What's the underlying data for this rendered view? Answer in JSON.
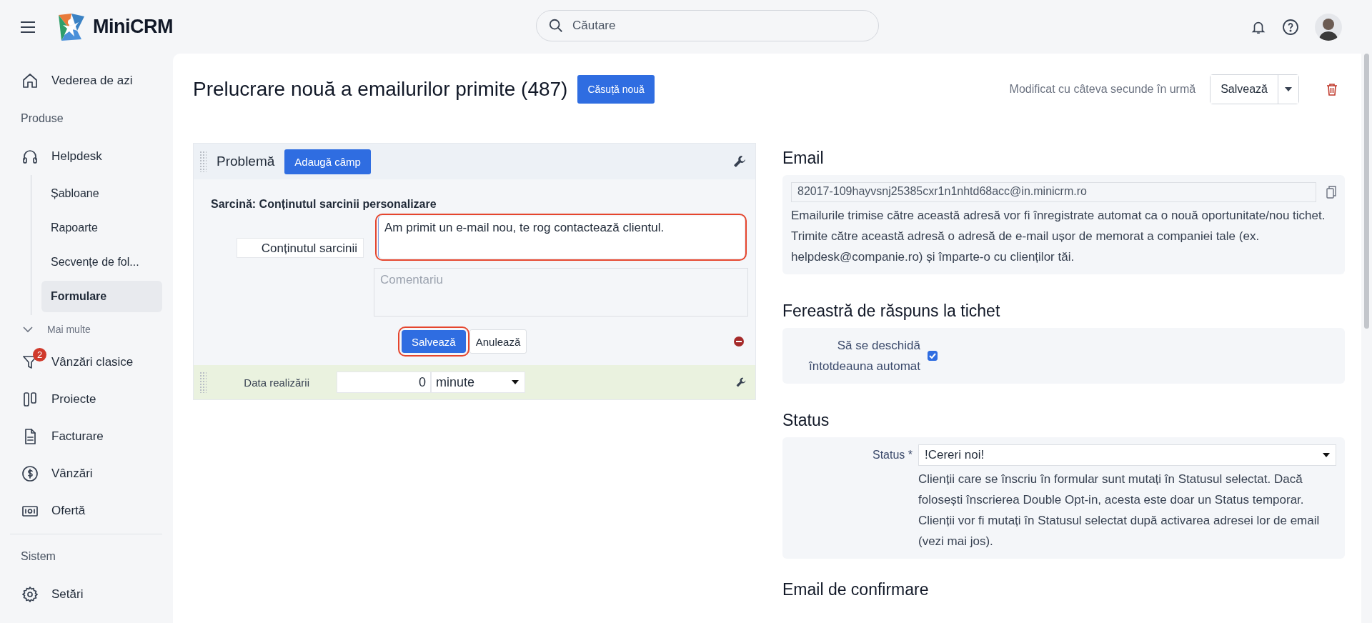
{
  "header": {
    "logo": "MiniCRM",
    "search": {
      "placeholder": "Căutare"
    }
  },
  "sidebar": [
    {
      "kind": "nav",
      "label": "Vederea de azi"
    },
    {
      "kind": "heading",
      "label": "Produse"
    },
    {
      "kind": "nav",
      "label": "Helpdesk",
      "children": [
        {
          "label": "Șabloane",
          "selected": false
        },
        {
          "label": "Rapoarte",
          "selected": false
        },
        {
          "label": "Secvențe de fol...",
          "selected": false
        },
        {
          "label": "Formulare",
          "selected": true
        }
      ]
    },
    {
      "kind": "more",
      "label": "Mai multe"
    },
    {
      "kind": "nav",
      "label": "Vânzări clasice",
      "badge": "2"
    },
    {
      "kind": "nav",
      "label": "Proiecte"
    },
    {
      "kind": "nav",
      "label": "Facturare"
    },
    {
      "kind": "nav",
      "label": "Vânzări"
    },
    {
      "kind": "nav",
      "label": "Ofertă"
    },
    {
      "kind": "divider"
    },
    {
      "kind": "heading",
      "label": "Sistem"
    },
    {
      "kind": "nav",
      "label": "Setări"
    }
  ],
  "page": {
    "title": "Prelucrare nouă a emailurilor primite (487)",
    "new_button": "Căsuță nouă",
    "modified": "Modificat cu câteva secunde în urmă",
    "save": "Salvează"
  },
  "form": {
    "section_title": "Problemă",
    "add_field": "Adaugă câmp",
    "task_heading": "Sarcină: Conținutul sarcinii personalizare",
    "field_label": "Conținutul sarcinii",
    "field_value": "Am primit un e-mail nou, te rog contactează clientul.",
    "field_highlighted": true,
    "comment": {
      "placeholder": "Comentariu"
    },
    "save": {
      "label": "Salvează",
      "highlighted": true
    },
    "cancel": "Anulează",
    "due": {
      "label": "Data realizării",
      "value": "0",
      "unit": "minute"
    }
  },
  "email": {
    "title": "Email",
    "address": "82017-109hayvsnj25385cxr1n1nhtd68acc@in.minicrm.ro",
    "description": "Emailurile trimise către această adresă vor fi înregistrate automat ca o nouă oportunitate/nou tichet. Trimite către această adresă o adresă de e-mail ușor de memorat a companiei tale (ex. helpdesk@companie.ro) și împarte-o cu clienților tăi."
  },
  "reply_window": {
    "title": "Fereastră de răspuns la tichet",
    "label": "Să se deschidă întotdeauna automat",
    "checked": true
  },
  "status": {
    "title": "Status",
    "label": "Status *",
    "value": "!Cereri noi!",
    "help": "Clienții care se înscriu în formular sunt mutați în Statusul selectat. Dacă folosești înscrierea Double Opt-in, acesta este doar un Status temporar. Clienții vor fi mutați în Statusul selectat după activarea adresei lor de email (vezi mai jos)."
  },
  "confirmation": {
    "title": "Email de confirmare"
  }
}
